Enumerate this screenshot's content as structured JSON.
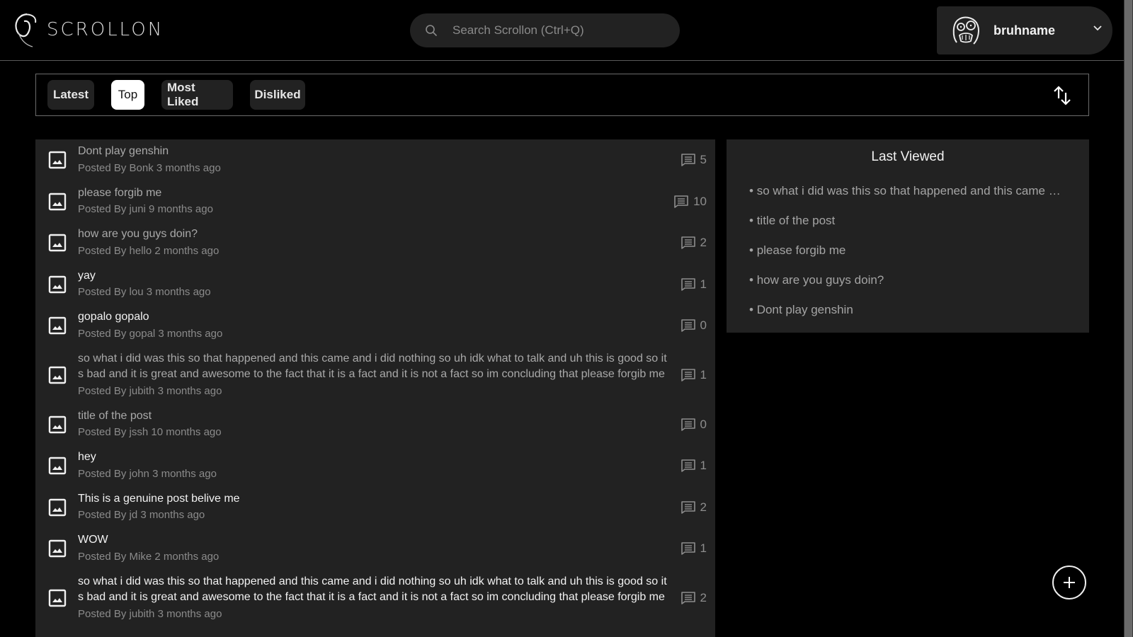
{
  "app": {
    "logo_text": "SCROLLON"
  },
  "search": {
    "placeholder": "Search Scrollon (Ctrl+Q)",
    "value": ""
  },
  "user": {
    "name": "bruhname",
    "avatar_icon": "rage-face-avatar",
    "menu_icon": "chevron-down-icon"
  },
  "filters": {
    "tabs": [
      {
        "label": "Latest",
        "active": false
      },
      {
        "label": "Top",
        "active": true
      },
      {
        "label": "Most Liked",
        "active": false
      },
      {
        "label": "Disliked",
        "active": false
      }
    ],
    "sort_icon": "sort-arrows-icon"
  },
  "posts": [
    {
      "title": "Dont play genshin",
      "author": "Bonk",
      "age": "3 months ago",
      "meta": "Posted By Bonk 3 months ago",
      "comments": "5",
      "viewed": true
    },
    {
      "title": "please forgib me",
      "author": "juni",
      "age": "9 months ago",
      "meta": "Posted By juni 9 months ago",
      "comments": "10",
      "viewed": true
    },
    {
      "title": "how are you guys doin?",
      "author": "hello",
      "age": "2 months ago",
      "meta": "Posted By hello 2 months ago",
      "comments": "2",
      "viewed": true
    },
    {
      "title": "yay",
      "author": "lou",
      "age": "3 months ago",
      "meta": "Posted By lou 3 months ago",
      "comments": "1",
      "viewed": false
    },
    {
      "title": "gopalo gopalo",
      "author": "gopal",
      "age": "3 months ago",
      "meta": "Posted By gopal 3 months ago",
      "comments": "0",
      "viewed": false
    },
    {
      "title": "so what i did was this so that happened and this came and i did nothing so uh idk what to talk and uh this is good so it s bad and it is great and awesome to the fact that it is a fact and it is not a fact so im concluding that please forgib me",
      "author": "jubith",
      "age": "3 months ago",
      "meta": "Posted By jubith 3 months ago",
      "comments": "1",
      "viewed": true
    },
    {
      "title": "title of the post",
      "author": "jssh",
      "age": "10 months ago",
      "meta": "Posted By jssh 10 months ago",
      "comments": "0",
      "viewed": true
    },
    {
      "title": "hey",
      "author": "john",
      "age": "3 months ago",
      "meta": "Posted By john 3 months ago",
      "comments": "1",
      "viewed": false
    },
    {
      "title": "This is a genuine post belive me",
      "author": "jd",
      "age": "3 months ago",
      "meta": "Posted By jd 3 months ago",
      "comments": "2",
      "viewed": false
    },
    {
      "title": "WOW",
      "author": "Mike",
      "age": "2 months ago",
      "meta": "Posted By Mike 2 months ago",
      "comments": "1",
      "viewed": false
    },
    {
      "title": "so what i did was this so that happened and this came and i did nothing so uh idk what to talk and uh this is good so it s bad and it is great and awesome to the fact that it is a fact and it is not a fact so im concluding that please forgib me",
      "author": "jubith",
      "age": "3 months ago",
      "meta": "Posted By jubith 3 months ago",
      "comments": "2",
      "viewed": false
    }
  ],
  "last_viewed": {
    "title": "Last Viewed",
    "items": [
      "so what i did was this so that happened and this came and i did nothing so uh idk what to talk and uh this is good",
      "title of the post",
      "please forgib me",
      "how are you guys doin?",
      "Dont play genshin"
    ]
  },
  "fab": {
    "icon": "plus-icon",
    "action": "create-post"
  },
  "colors": {
    "background": "#000000",
    "panel": "#222222",
    "border": "#6c6c6c",
    "text_primary": "#f2f2f2",
    "text_secondary": "#a9a9a9",
    "text_muted": "#8b8b8b",
    "active_tab_bg": "#ffffff"
  }
}
